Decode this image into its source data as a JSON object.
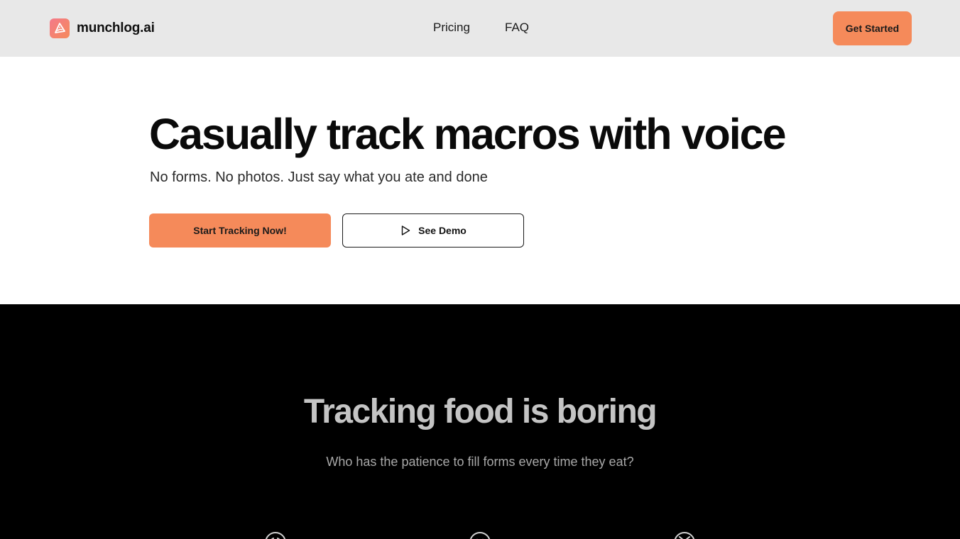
{
  "header": {
    "brand_name": "munchlog.ai",
    "logo_icon": "pizza-slice-icon",
    "nav": {
      "pricing_label": "Pricing",
      "faq_label": "FAQ"
    },
    "cta_label": "Get Started"
  },
  "hero": {
    "title": "Casually track macros with voice",
    "subtitle": "No forms. No photos. Just say what you ate and done",
    "primary_button_label": "Start Tracking Now!",
    "secondary_button_label": "See Demo",
    "secondary_button_icon": "play-icon"
  },
  "problem_section": {
    "title": "Tracking food is boring",
    "subtitle": "Who has the patience to fill forms every time they eat?",
    "icons": [
      "sad-face-icon",
      "neutral-face-icon",
      "annoyed-face-icon"
    ]
  },
  "colors": {
    "accent": "#f58a5a",
    "header_bg": "#e8e8e8",
    "dark_section_bg": "#000000",
    "dark_title": "#c4c4c4",
    "dark_subtitle": "#a8a8a8"
  }
}
